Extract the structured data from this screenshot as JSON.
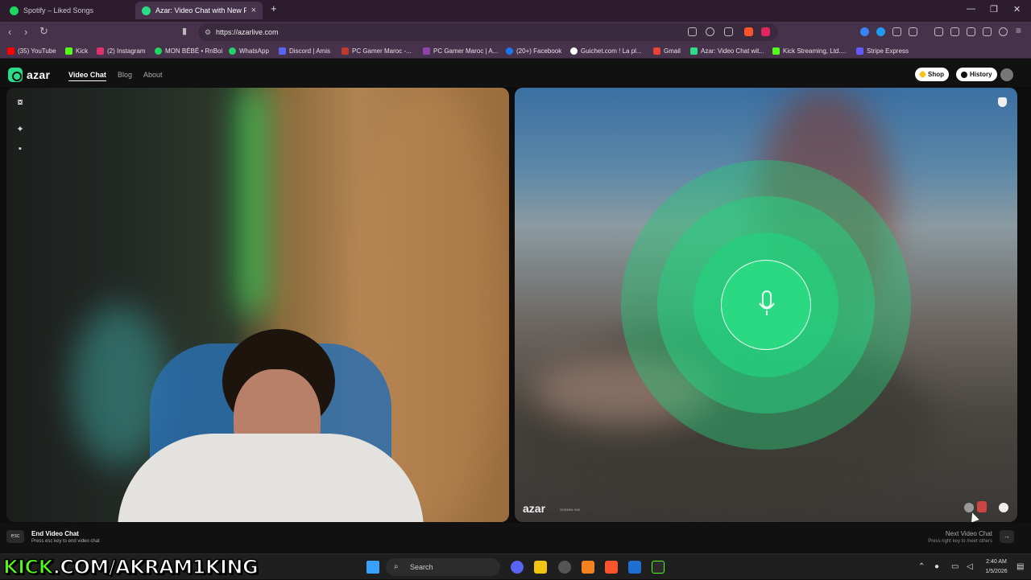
{
  "browser": {
    "tabs": [
      {
        "title": "Spotify – Liked Songs",
        "active": false,
        "favicon_color": "#1ed760"
      },
      {
        "title": "Azar: Video Chat with New People",
        "active": true,
        "favicon_color": "#2bdd88"
      }
    ],
    "new_tab": "+",
    "url": "https://azarlive.com",
    "bookmarks": [
      {
        "label": "(35) YouTube",
        "color": "#ff0000"
      },
      {
        "label": "Kick",
        "color": "#53fc18"
      },
      {
        "label": "(2) Instagram",
        "color": "#e1306c"
      },
      {
        "label": "MON BÉBÉ • RnBoi",
        "color": "#1ed760"
      },
      {
        "label": "WhatsApp",
        "color": "#25d366"
      },
      {
        "label": "Discord | Amis",
        "color": "#5865f2"
      },
      {
        "label": "PC Gamer Maroc -...",
        "color": "#c0392b"
      },
      {
        "label": "PC Gamer Maroc | A...",
        "color": "#8e44ad"
      },
      {
        "label": "(20+) Facebook",
        "color": "#1877f2"
      },
      {
        "label": "Guichet.com ! La pl...",
        "color": "#ffffff"
      },
      {
        "label": "Gmail",
        "color": "#ea4335"
      },
      {
        "label": "Azar: Video Chat wit...",
        "color": "#2bdd88"
      },
      {
        "label": "Kick Streaming, Ltd....",
        "color": "#53fc18"
      },
      {
        "label": "Stripe Express",
        "color": "#635bff"
      }
    ]
  },
  "azar": {
    "logo": "azar",
    "nav": [
      {
        "label": "Video Chat",
        "active": true
      },
      {
        "label": "Blog",
        "active": false
      },
      {
        "label": "About",
        "active": false
      }
    ],
    "shop_label": "Shop",
    "history_label": "History",
    "watermark": "azar",
    "watermark_sub": "SOKMNL·543",
    "end_chat": {
      "key": "esc",
      "title": "End Video Chat",
      "hint": "Press esc key to end video chat"
    },
    "next_chat": {
      "title": "Next Video Chat",
      "hint": "Press right key to meet others",
      "key": "→"
    }
  },
  "taskbar": {
    "banner_prefix": "KICK",
    "banner_rest": ".COM/AKRAM1KING",
    "search_placeholder": "Search",
    "time": "2:40 AM",
    "date": "1/5/2026"
  }
}
